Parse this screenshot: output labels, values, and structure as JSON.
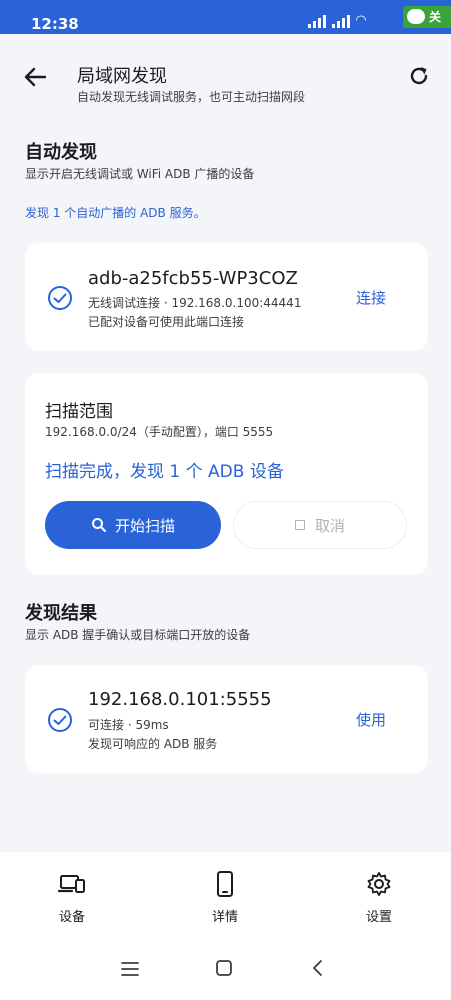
{
  "status_bar": {
    "time": "12:38",
    "wechat_label": "关"
  },
  "app_bar": {
    "title": "局域网发现",
    "subtitle": "自动发现无线调试服务，也可主动扫描网段"
  },
  "auto_discovery": {
    "title": "自动发现",
    "subtitle": "显示开启无线调试或 WiFi ADB 广播的设备",
    "found_text": "发现 1 个自动广播的 ADB 服务。",
    "device": {
      "name": "adb-a25fcb55-WP3COZ",
      "line1": "无线调试连接 · 192.168.0.100:44441",
      "line2": "已配对设备可使用此端口连接",
      "action": "连接"
    }
  },
  "scan": {
    "title": "扫描范围",
    "range": "192.168.0.0/24（手动配置），端口 5555",
    "status": "扫描完成，发现 1 个 ADB 设备",
    "start_label": "开始扫描",
    "cancel_label": "取消"
  },
  "results": {
    "title": "发现结果",
    "subtitle": "显示 ADB 握手确认或目标端口开放的设备",
    "device": {
      "name": "192.168.0.101:5555",
      "line1": "可连接 · 59ms",
      "line2": "发现可响应的 ADB 服务",
      "action": "使用"
    }
  },
  "bottom_nav": [
    {
      "label": "设备",
      "icon": "devices-icon"
    },
    {
      "label": "详情",
      "icon": "phone-icon"
    },
    {
      "label": "设置",
      "icon": "gear-icon"
    }
  ],
  "colors": {
    "accent": "#2a62d8",
    "background": "#f4f5f9",
    "card": "#ffffff"
  }
}
